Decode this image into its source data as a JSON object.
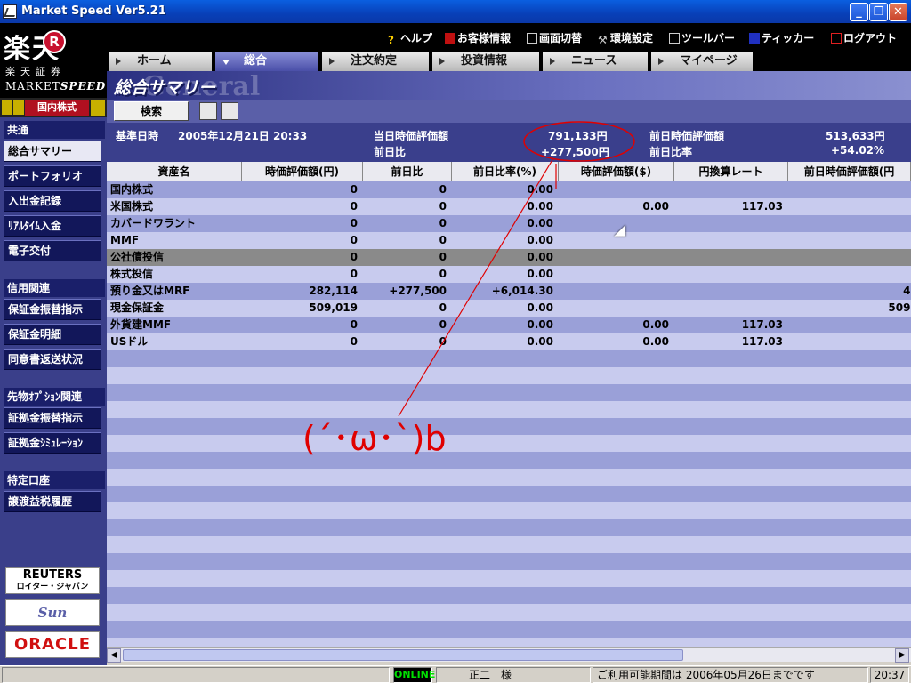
{
  "window": {
    "title": "Market Speed Ver5.21"
  },
  "logo": {
    "kanji": "楽天",
    "r": "R",
    "sub": "楽天証券",
    "brand_prefix": "MARKET",
    "brand_suffix": "SPEED"
  },
  "market_select": {
    "label": "国内株式"
  },
  "sidebar": {
    "sections": [
      {
        "header": "共通",
        "items": [
          "総合サマリー",
          "ポートフォリオ",
          "入出金記録",
          "ﾘｱﾙﾀｲﾑ入金",
          "電子交付"
        ]
      },
      {
        "header": "信用関連",
        "items": [
          "保証金振替指示",
          "保証金明細",
          "同意書返送状況"
        ]
      },
      {
        "header": "先物ｵﾌﾟｼｮﾝ関連",
        "items": [
          "証拠金振替指示",
          "証拠金ｼﾐｭﾚｰｼｮﾝ"
        ]
      },
      {
        "header": "特定口座",
        "items": [
          "譲渡益税履歴"
        ]
      }
    ],
    "partners": [
      "REUTERS",
      "ロイター・ジャパン",
      "Sun",
      "ORACLE"
    ]
  },
  "toplinks": [
    "ヘルプ",
    "お客様情報",
    "画面切替",
    "環境設定",
    "ツールバー",
    "ティッカー",
    "ログアウト"
  ],
  "tabs": [
    "ホーム",
    "総合",
    "注文約定",
    "投資情報",
    "ニュース",
    "マイページ"
  ],
  "page": {
    "title": "総合サマリー",
    "ghost": "General"
  },
  "toolbar": {
    "search_label": "検索"
  },
  "summary": {
    "date_label": "基準日時",
    "date_value": "2005年12月21日 20:33",
    "current_label": "当日時価評価額",
    "current_value": "791,133円",
    "change_label": "前日比",
    "change_value": "+277,500円",
    "prev_label": "前日時価評価額",
    "prev_value": "513,633円",
    "ratio_label": "前日比率",
    "ratio_value": "+54.02%"
  },
  "table": {
    "headers": [
      "資産名",
      "時価評価額(円)",
      "前日比",
      "前日比率(%)",
      "時価評価額($)",
      "円換算レート",
      "前日時価評価額(円"
    ],
    "rows": [
      [
        "国内株式",
        "0",
        "0",
        "0.00",
        "",
        "",
        ""
      ],
      [
        "米国株式",
        "0",
        "0",
        "0.00",
        "0.00",
        "117.03",
        ""
      ],
      [
        "カバードワラント",
        "0",
        "0",
        "0.00",
        "",
        "",
        ""
      ],
      [
        "MMF",
        "0",
        "0",
        "0.00",
        "",
        "",
        ""
      ],
      [
        "公社債投信",
        "0",
        "0",
        "0.00",
        "",
        "",
        ""
      ],
      [
        "株式投信",
        "0",
        "0",
        "0.00",
        "",
        "",
        ""
      ],
      [
        "預り金又はMRF",
        "282,114",
        "+277,500",
        "+6,014.30",
        "",
        "",
        "4,"
      ],
      [
        "現金保証金",
        "509,019",
        "0",
        "0.00",
        "",
        "",
        "509,"
      ],
      [
        "外貨建MMF",
        "0",
        "0",
        "0.00",
        "0.00",
        "117.03",
        ""
      ],
      [
        "USドル",
        "0",
        "0",
        "0.00",
        "0.00",
        "117.03",
        ""
      ]
    ],
    "selected_row": 4
  },
  "status": {
    "online": "ONLINE",
    "user": "正二　様",
    "period": "ご利用可能期間は 2006年05月26日までです",
    "time": "20:37"
  },
  "annotation": {
    "face": "(´･ω･`)b"
  }
}
